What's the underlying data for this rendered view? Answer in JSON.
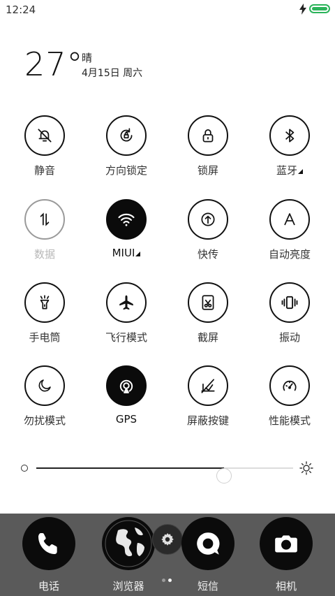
{
  "status": {
    "time": "12:24",
    "battery_level": 1.0,
    "battery_color": "#2bb35a"
  },
  "weather": {
    "temperature": "27°",
    "condition": "晴",
    "date": "4月15日 周六"
  },
  "toggles": [
    {
      "label": "静音",
      "icon": "bell-slash-icon",
      "state": "off"
    },
    {
      "label": "方向锁定",
      "icon": "rotation-lock-icon",
      "state": "off"
    },
    {
      "label": "锁屏",
      "icon": "lock-icon",
      "state": "off"
    },
    {
      "label": "蓝牙",
      "icon": "bluetooth-icon",
      "state": "off",
      "expandable": true
    },
    {
      "label": "数据",
      "icon": "data-arrows-icon",
      "state": "disabled"
    },
    {
      "label": "MIUI",
      "icon": "wifi-icon",
      "state": "on",
      "expandable": true
    },
    {
      "label": "快传",
      "icon": "upload-icon",
      "state": "off"
    },
    {
      "label": "自动亮度",
      "icon": "auto-brightness-icon",
      "state": "off"
    },
    {
      "label": "手电筒",
      "icon": "flashlight-icon",
      "state": "off"
    },
    {
      "label": "飞行模式",
      "icon": "airplane-icon",
      "state": "off"
    },
    {
      "label": "截屏",
      "icon": "screenshot-icon",
      "state": "off"
    },
    {
      "label": "振动",
      "icon": "vibrate-icon",
      "state": "off"
    },
    {
      "label": "勿扰模式",
      "icon": "moon-icon",
      "state": "off"
    },
    {
      "label": "GPS",
      "icon": "gps-icon",
      "state": "on"
    },
    {
      "label": "屏蔽按键",
      "icon": "block-keys-icon",
      "state": "off"
    },
    {
      "label": "性能模式",
      "icon": "speedometer-icon",
      "state": "off"
    }
  ],
  "brightness": {
    "level": 0.73
  },
  "dock": {
    "apps": [
      {
        "label": "电话",
        "icon": "phone-icon"
      },
      {
        "label": "浏览器",
        "icon": "globe-icon"
      },
      {
        "label": "短信",
        "icon": "message-icon"
      },
      {
        "label": "相机",
        "icon": "camera-icon"
      }
    ],
    "settings_icon": "gear-icon",
    "pages": 2,
    "current_page": 2
  }
}
